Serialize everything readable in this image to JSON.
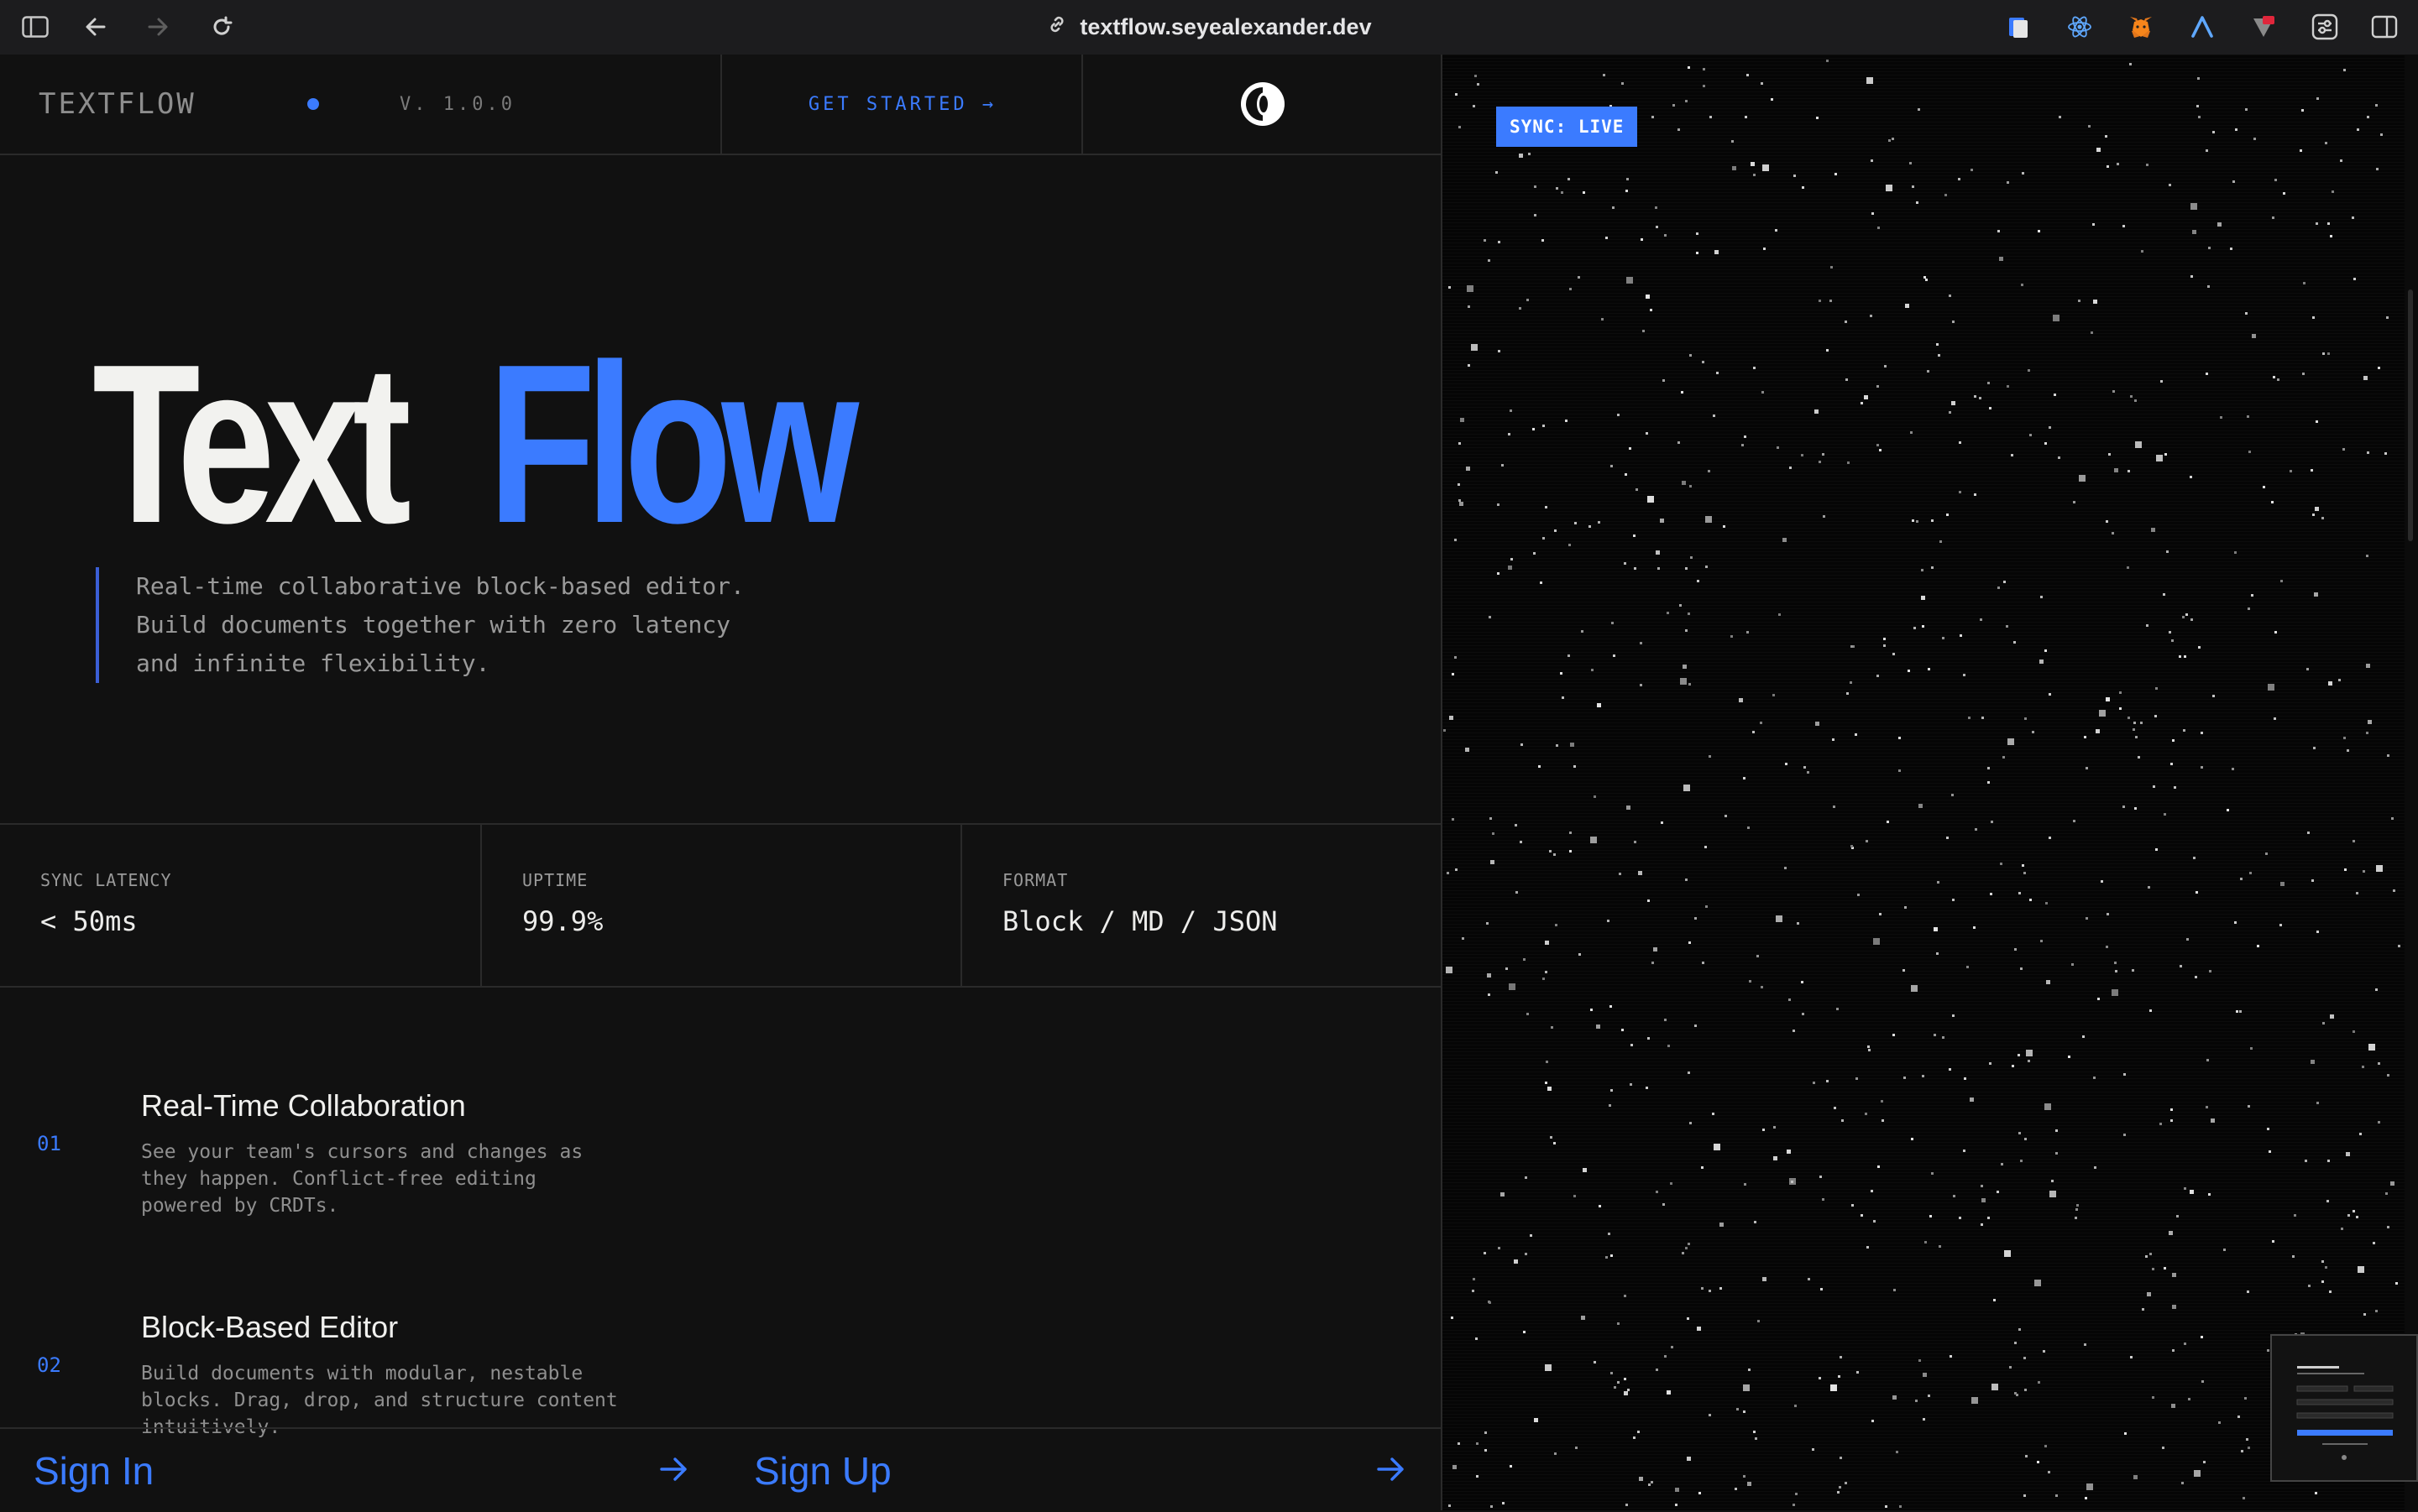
{
  "browser": {
    "url": "textflow.seyealexander.dev",
    "icons": [
      "sidebar-toggle-icon",
      "back-arrow-icon",
      "forward-arrow-icon",
      "reload-icon",
      "link-icon"
    ],
    "extensions": [
      "clipboard-extension-icon",
      "react-devtools-icon",
      "metamask-fox-icon",
      "a-logo-extension-icon",
      "shield-flag-extension-icon",
      "sliders-extension-icon",
      "split-view-icon"
    ]
  },
  "header": {
    "logo": "TEXTFLOW",
    "version": "V. 1.0.0",
    "cta": "GET STARTED →"
  },
  "hero": {
    "title_part1": "Text",
    "title_part2": "Flow",
    "tagline": [
      "Real-time collaborative block-based editor.",
      "Build documents together with zero latency",
      "and infinite flexibility."
    ]
  },
  "stats": [
    {
      "label": "SYNC LATENCY",
      "value": "< 50ms"
    },
    {
      "label": "UPTIME",
      "value": "99.9%"
    },
    {
      "label": "FORMAT",
      "value": "Block / MD / JSON"
    }
  ],
  "features": [
    {
      "number": "01",
      "title": "Real-Time Collaboration",
      "desc": [
        "See your team's cursors and changes as",
        "they happen. Conflict-free editing",
        "powered by CRDTs."
      ]
    },
    {
      "number": "02",
      "title": "Block-Based Editor",
      "desc": [
        "Build documents with modular, nestable",
        "blocks. Drag, drop, and structure content",
        "intuitively."
      ]
    }
  ],
  "auth": {
    "sign_in": "Sign In",
    "sign_up": "Sign Up"
  },
  "visual": {
    "badge": "SYNC: LIVE"
  },
  "colors": {
    "accent": "#3b7bff",
    "background": "#111111",
    "text": "#f2f2ef"
  }
}
